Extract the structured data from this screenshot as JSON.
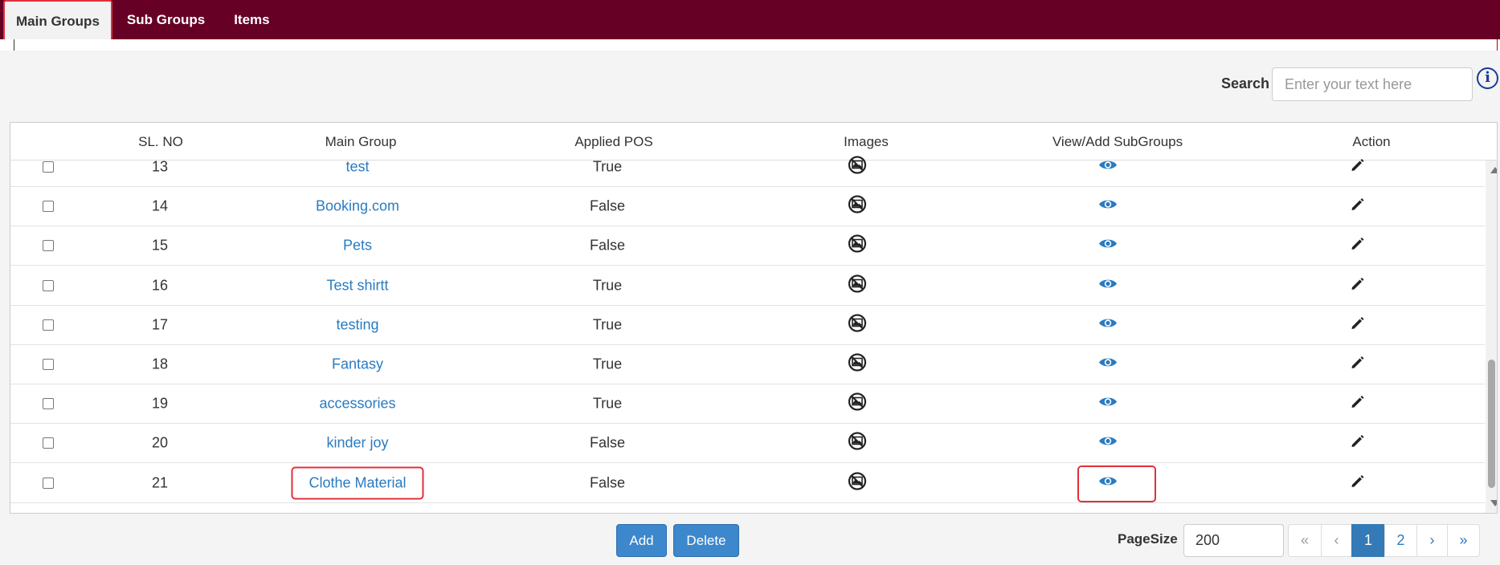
{
  "tabs": [
    {
      "label": "Main Groups",
      "active": true
    },
    {
      "label": "Sub Groups",
      "active": false
    },
    {
      "label": "Items",
      "active": false
    }
  ],
  "search": {
    "label": "Search",
    "placeholder": "Enter your text here"
  },
  "info_icon": "info-icon",
  "table": {
    "headers": {
      "sl_no": "SL. NO",
      "main_group": "Main Group",
      "applied_pos": "Applied POS",
      "images": "Images",
      "view_add": "View/Add SubGroups",
      "action": "Action"
    },
    "rows": [
      {
        "sl": "13",
        "name": "test",
        "pos": "True"
      },
      {
        "sl": "14",
        "name": "Booking.com",
        "pos": "False"
      },
      {
        "sl": "15",
        "name": "Pets",
        "pos": "False"
      },
      {
        "sl": "16",
        "name": "Test shirtt",
        "pos": "True"
      },
      {
        "sl": "17",
        "name": "testing",
        "pos": "True"
      },
      {
        "sl": "18",
        "name": "Fantasy",
        "pos": "True"
      },
      {
        "sl": "19",
        "name": "accessories",
        "pos": "True"
      },
      {
        "sl": "20",
        "name": "kinder joy",
        "pos": "False"
      },
      {
        "sl": "21",
        "name": "Clothe Material",
        "pos": "False"
      }
    ],
    "icons": {
      "images": "no-image-icon",
      "view": "eye-icon",
      "action": "pencil-icon"
    }
  },
  "buttons": {
    "add": "Add",
    "delete": "Delete"
  },
  "pagination": {
    "pagesize_label": "PageSize",
    "pagesize_value": "200",
    "first": "«",
    "prev": "‹",
    "pages": [
      "1",
      "2"
    ],
    "current_page": "1",
    "next": "›",
    "last": "»"
  },
  "colors": {
    "brand": "#660024",
    "accent": "#337ab7",
    "link": "#2a7bc0",
    "highlight": "#e0303a"
  }
}
